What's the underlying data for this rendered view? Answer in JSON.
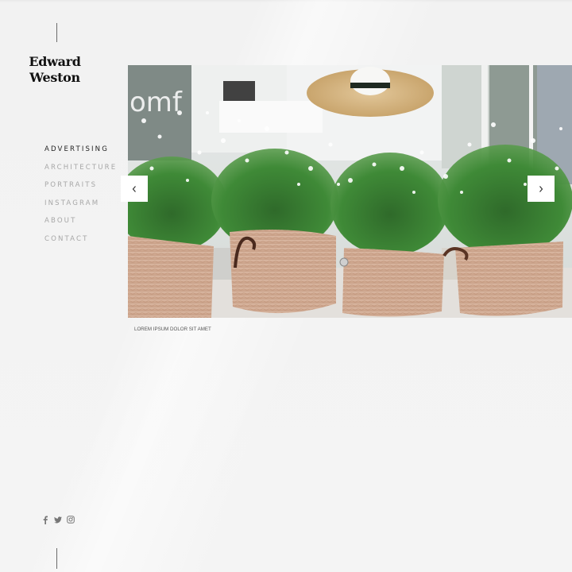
{
  "brand": {
    "line1": "Edward",
    "line2": "Weston"
  },
  "nav": {
    "items": [
      {
        "label": "ADVERTISING",
        "active": true
      },
      {
        "label": "ARCHITECTURE",
        "active": false
      },
      {
        "label": "PORTRAITS",
        "active": false
      },
      {
        "label": "INSTAGRAM",
        "active": false
      },
      {
        "label": "ABOUT",
        "active": false
      },
      {
        "label": "CONTACT",
        "active": false
      }
    ]
  },
  "slider": {
    "image_alt": "Woven straw baskets filled with white-flowering plants in front of a shop window with a straw hat",
    "prev_icon": "chevron-left-icon",
    "next_icon": "chevron-right-icon",
    "prev_glyph": "‹",
    "next_glyph": "›",
    "caption": "LOREM IPSUM DOLOR SIT AMET"
  },
  "social": {
    "icons": [
      "facebook-icon",
      "twitter-icon",
      "instagram-icon"
    ]
  },
  "colors": {
    "background": "#f3f3f3",
    "text_active": "#222222",
    "text_muted": "#a7a7a7",
    "brand": "#111111"
  }
}
